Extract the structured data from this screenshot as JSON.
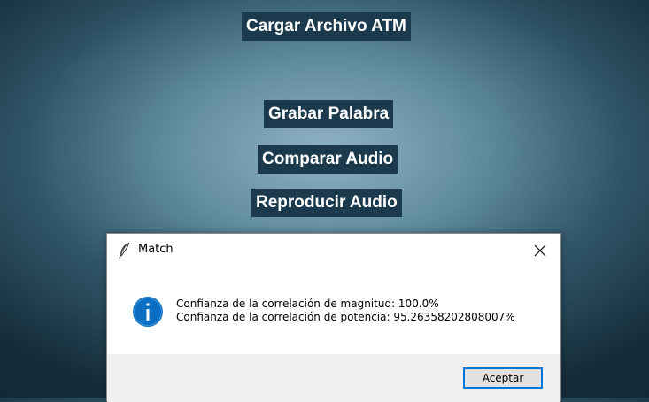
{
  "app": {
    "buttons": {
      "load_atm": "Cargar Archivo ATM",
      "record_word": "Grabar Palabra",
      "compare_audio": "Comparar Audio",
      "play_audio": "Reproducir Audio"
    }
  },
  "dialog": {
    "title": "Match",
    "title_icon": "feather-icon",
    "close_icon": "close-icon",
    "message_icon": "info-icon",
    "message_lines": [
      "Confianza de la correlación de magnitud: 100.0%",
      "Confianza de la correlación de potencia: 95.26358202808007%"
    ],
    "ok_label": "Aceptar"
  },
  "colors": {
    "app_button_bg": "#1b3a4d",
    "app_button_text": "#ffffff",
    "info_icon": "#0a6fc2",
    "ok_button_border": "#0078d7",
    "dialog_footer_bg": "#f0f0f0"
  }
}
